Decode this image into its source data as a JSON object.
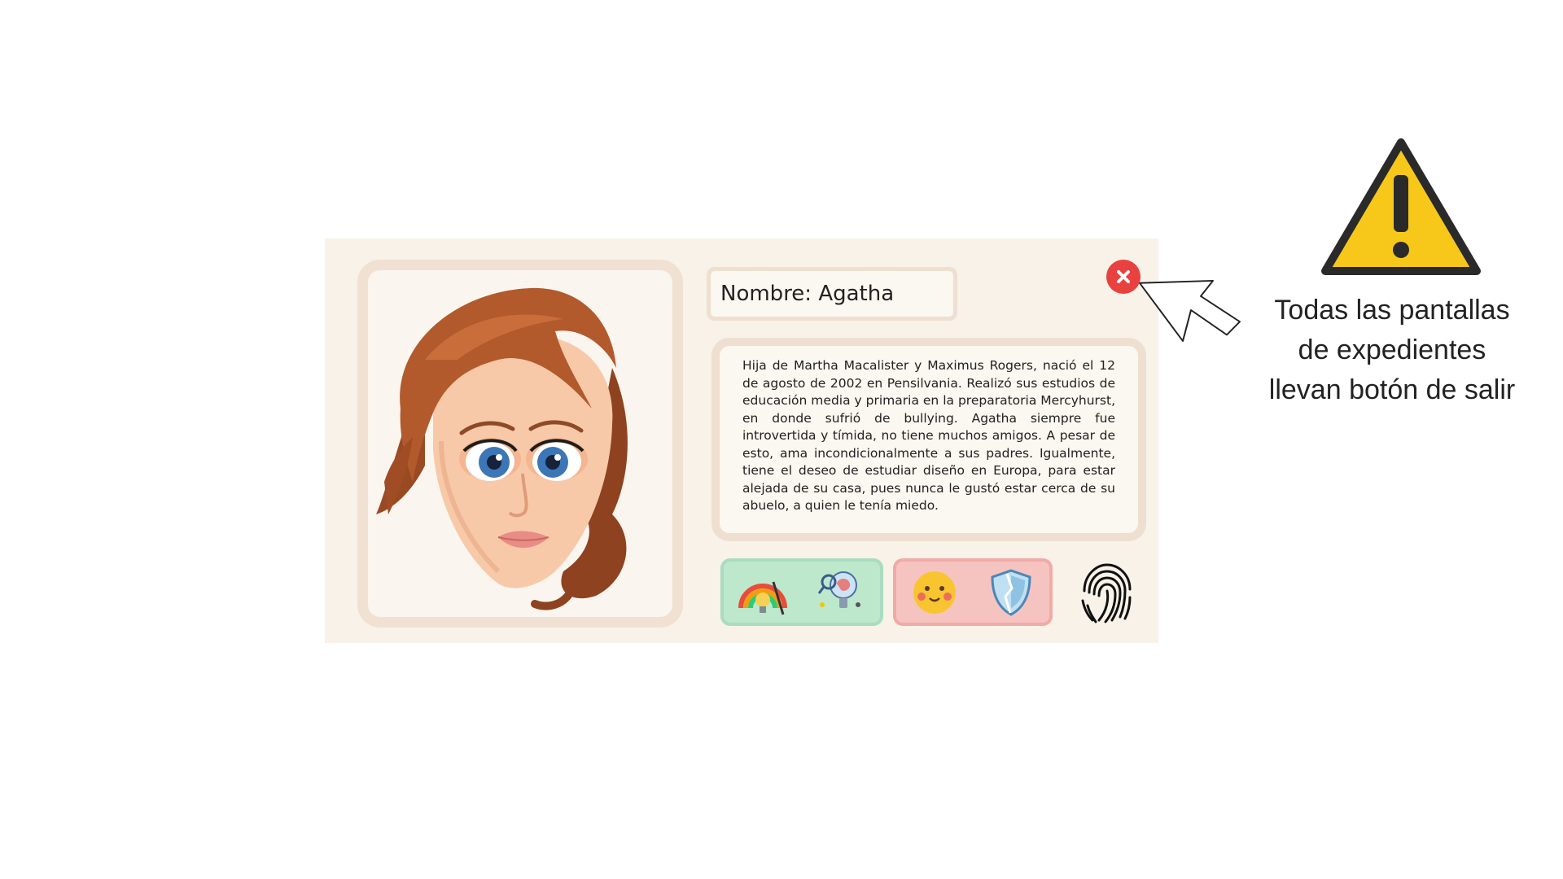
{
  "profile": {
    "name_label": "Nombre: Agatha",
    "bio": "Hija de Martha Macalister y Maximus Rogers, nació el 12 de agosto de 2002 en Pensilvania. Realizó sus estudios de educación media y primaria en la preparatoria Mercyhurst, en donde sufrió de bullying. Agatha siempre fue introvertida y tímida, no tiene muchos amigos. A pesar de esto, ama incondicionalmente a sus padres. Igualmente, tiene el deseo de estudiar diseño en Europa, para estar alejada de su casa, pues nunca le gustó estar cerca de su abuelo, a quien le tenía miedo."
  },
  "badges": {
    "green": [
      "creativity-icon",
      "brain-idea-icon"
    ],
    "red": [
      "blush-face-icon",
      "shield-icon"
    ]
  },
  "annotation": {
    "lines": [
      "Todas las pantallas",
      "de expedientes",
      "llevan botón de salir"
    ]
  },
  "colors": {
    "card_bg": "#f8f2e8",
    "frame": "#efdfd0",
    "close": "#e8413f",
    "badge_green": "#bde8cc",
    "badge_red": "#f6c4c0",
    "warning": "#f7c81a"
  }
}
